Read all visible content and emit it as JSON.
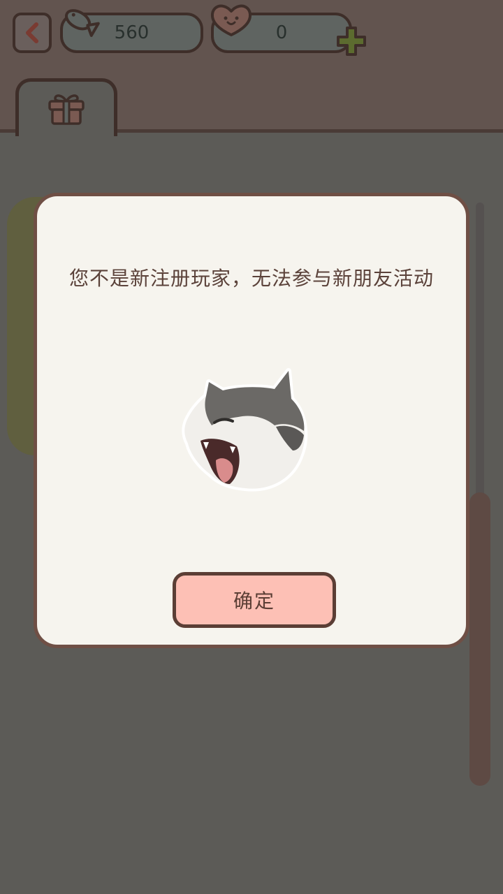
{
  "header": {
    "fish_count": "560",
    "heart_count": "0"
  },
  "tabs": [
    {
      "icon": "gift-icon",
      "active": true
    }
  ],
  "dialog": {
    "message": "您不是新注册玩家，无法参与新朋友活动",
    "confirm_label": "确定",
    "image": "yawning-cat-sticker"
  },
  "colors": {
    "overlay": "#5c5b57",
    "dialog_bg": "#f6f4ee",
    "dialog_border": "#6f4f45",
    "confirm_bg": "#fdc0b5",
    "text": "#5b423a"
  }
}
